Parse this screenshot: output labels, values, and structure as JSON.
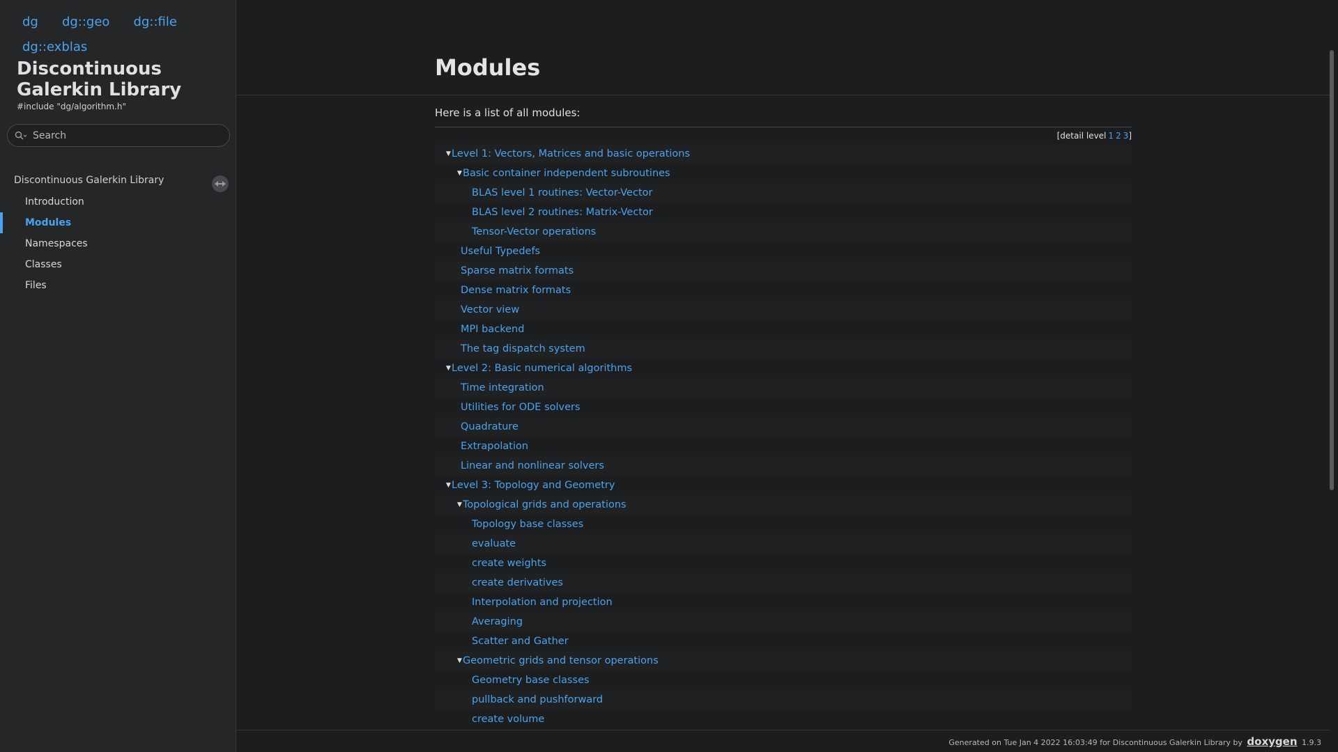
{
  "sidebar": {
    "top_links": [
      "dg",
      "dg::geo",
      "dg::file",
      "dg::exblas"
    ],
    "project_title": "Discontinuous Galerkin Library",
    "project_brief": "#include \"dg/algorithm.h\"",
    "search": {
      "placeholder": "Search",
      "icon": "search-icon"
    },
    "nav_root": "Discontinuous Galerkin Library",
    "nav_items": [
      {
        "label": "Introduction",
        "active": false
      },
      {
        "label": "Modules",
        "active": true
      },
      {
        "label": "Namespaces",
        "active": false
      },
      {
        "label": "Classes",
        "active": false
      },
      {
        "label": "Files",
        "active": false
      }
    ]
  },
  "main": {
    "title": "Modules",
    "intro": "Here is a list of all modules:",
    "detail_level": {
      "prefix": "[detail level",
      "levels": [
        "1",
        "2",
        "3"
      ],
      "suffix": "]"
    },
    "tree": [
      {
        "label": "Level 1: Vectors, Matrices and basic operations",
        "depth": 0,
        "expanded": true
      },
      {
        "label": "Basic container independent subroutines",
        "depth": 1,
        "expanded": true
      },
      {
        "label": "BLAS level 1 routines: Vector-Vector",
        "depth": 2
      },
      {
        "label": "BLAS level 2 routines: Matrix-Vector",
        "depth": 2
      },
      {
        "label": "Tensor-Vector operations",
        "depth": 2
      },
      {
        "label": "Useful Typedefs",
        "depth": 1
      },
      {
        "label": "Sparse matrix formats",
        "depth": 1
      },
      {
        "label": "Dense matrix formats",
        "depth": 1
      },
      {
        "label": "Vector view",
        "depth": 1
      },
      {
        "label": "MPI backend",
        "depth": 1
      },
      {
        "label": "The tag dispatch system",
        "depth": 1
      },
      {
        "label": "Level 2: Basic numerical algorithms",
        "depth": 0,
        "expanded": true
      },
      {
        "label": "Time integration",
        "depth": 1
      },
      {
        "label": "Utilities for ODE solvers",
        "depth": 1
      },
      {
        "label": "Quadrature",
        "depth": 1
      },
      {
        "label": "Extrapolation",
        "depth": 1
      },
      {
        "label": "Linear and nonlinear solvers",
        "depth": 1
      },
      {
        "label": "Level 3: Topology and Geometry",
        "depth": 0,
        "expanded": true
      },
      {
        "label": "Topological grids and operations",
        "depth": 1,
        "expanded": true
      },
      {
        "label": "Topology base classes",
        "depth": 2
      },
      {
        "label": "evaluate",
        "depth": 2
      },
      {
        "label": "create weights",
        "depth": 2
      },
      {
        "label": "create derivatives",
        "depth": 2
      },
      {
        "label": "Interpolation and projection",
        "depth": 2
      },
      {
        "label": "Averaging",
        "depth": 2
      },
      {
        "label": "Scatter and Gather",
        "depth": 2
      },
      {
        "label": "Geometric grids and tensor operations",
        "depth": 1,
        "expanded": true
      },
      {
        "label": "Geometry base classes",
        "depth": 2
      },
      {
        "label": "pullback and pushforward",
        "depth": 2
      },
      {
        "label": "create volume",
        "depth": 2
      }
    ]
  },
  "footer": {
    "text": "Generated on Tue Jan 4 2022 16:03:49 for Discontinuous Galerkin Library by",
    "logo": "doxygen",
    "version": "1.9.3"
  },
  "colors": {
    "accent": "#4aa3ee",
    "background": "#1c1d1f",
    "sidebar": "#252628"
  }
}
